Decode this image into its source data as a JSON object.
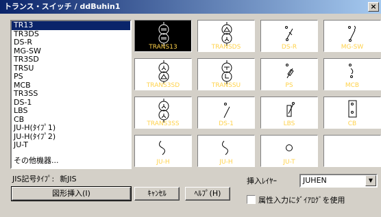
{
  "window": {
    "title": "トランス・スイッチ / ddBuhin1",
    "close_label": "×"
  },
  "list": {
    "items": [
      "TR13",
      "TR3DS",
      "DS-R",
      "MG-SW",
      "TR3SD",
      "TRSU",
      "PS",
      "MCB",
      "TR3SS",
      "DS-1",
      "LBS",
      "CB",
      "JU-H(ﾀｲﾌﾟ1)",
      "JU-H(ﾀｲﾌﾟ2)",
      "JU-T"
    ],
    "selected_index": 0,
    "other_label": "その他機器..."
  },
  "symbols": [
    {
      "caption": "TRANS13",
      "icon": "transformer-three-coil-icon",
      "selected": true
    },
    {
      "caption": "TRANSDS",
      "icon": "transformer-delta-star-icon",
      "selected": false
    },
    {
      "caption": "DS-R",
      "icon": "disconnect-switch-icon",
      "selected": false
    },
    {
      "caption": "MG-SW",
      "icon": "magnetic-switch-icon",
      "selected": false
    },
    {
      "caption": "TRANS3SD",
      "icon": "transformer-star-delta-icon",
      "selected": false
    },
    {
      "caption": "TRANSSU",
      "icon": "transformer-line-icon",
      "selected": false
    },
    {
      "caption": "PS",
      "icon": "power-switch-icon",
      "selected": false
    },
    {
      "caption": "MCB",
      "icon": "circuit-breaker-icon",
      "selected": false
    },
    {
      "caption": "TRANS3SS",
      "icon": "transformer-star-star-icon",
      "selected": false
    },
    {
      "caption": "DS-1",
      "icon": "disconnect-switch-single-icon",
      "selected": false
    },
    {
      "caption": "LBS",
      "icon": "load-break-switch-icon",
      "selected": false
    },
    {
      "caption": "CB",
      "icon": "breaker-box-icon",
      "selected": false
    },
    {
      "caption": "JU-H",
      "icon": "s-curve-icon",
      "selected": false
    },
    {
      "caption": "JU-H",
      "icon": "s-curve-icon",
      "selected": false
    },
    {
      "caption": "JU-T",
      "icon": "circle-terminal-icon",
      "selected": false
    },
    {
      "caption": "",
      "icon": "empty-icon",
      "selected": false
    }
  ],
  "jis": {
    "label": "JIS記号ﾀｲﾌﾟ:",
    "value": "新JIS"
  },
  "buttons": {
    "insert": "図形挿入(I)",
    "cancel": "ｷｬﾝｾﾙ",
    "help": "ﾍﾙﾌﾟ(H)"
  },
  "layer": {
    "label": "挿入ﾚｲﾔｰ",
    "value": "JUHEN"
  },
  "attribute_checkbox": {
    "label": "属性入力にﾀﾞｲｱﾛｸﾞを使用",
    "checked": false
  },
  "colors": {
    "caption": "#ffd24a",
    "selection": "#0a246a",
    "dialog": "#d4d0c8"
  }
}
